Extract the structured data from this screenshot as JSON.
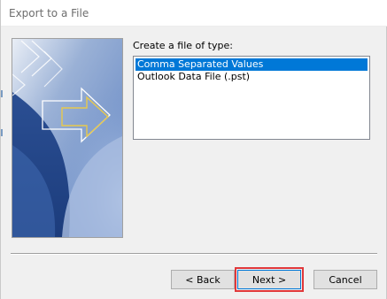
{
  "window": {
    "title": "Export to a File"
  },
  "wizard": {
    "prompt": "Create a file of type:",
    "file_types": [
      {
        "label": "Comma Separated Values",
        "selected": true
      },
      {
        "label": "Outlook Data File (.pst)",
        "selected": false
      }
    ]
  },
  "buttons": {
    "back": "< Back",
    "next": "Next >",
    "cancel": "Cancel"
  },
  "colors": {
    "selection": "#0078d7",
    "highlight_box": "#e0383b"
  }
}
